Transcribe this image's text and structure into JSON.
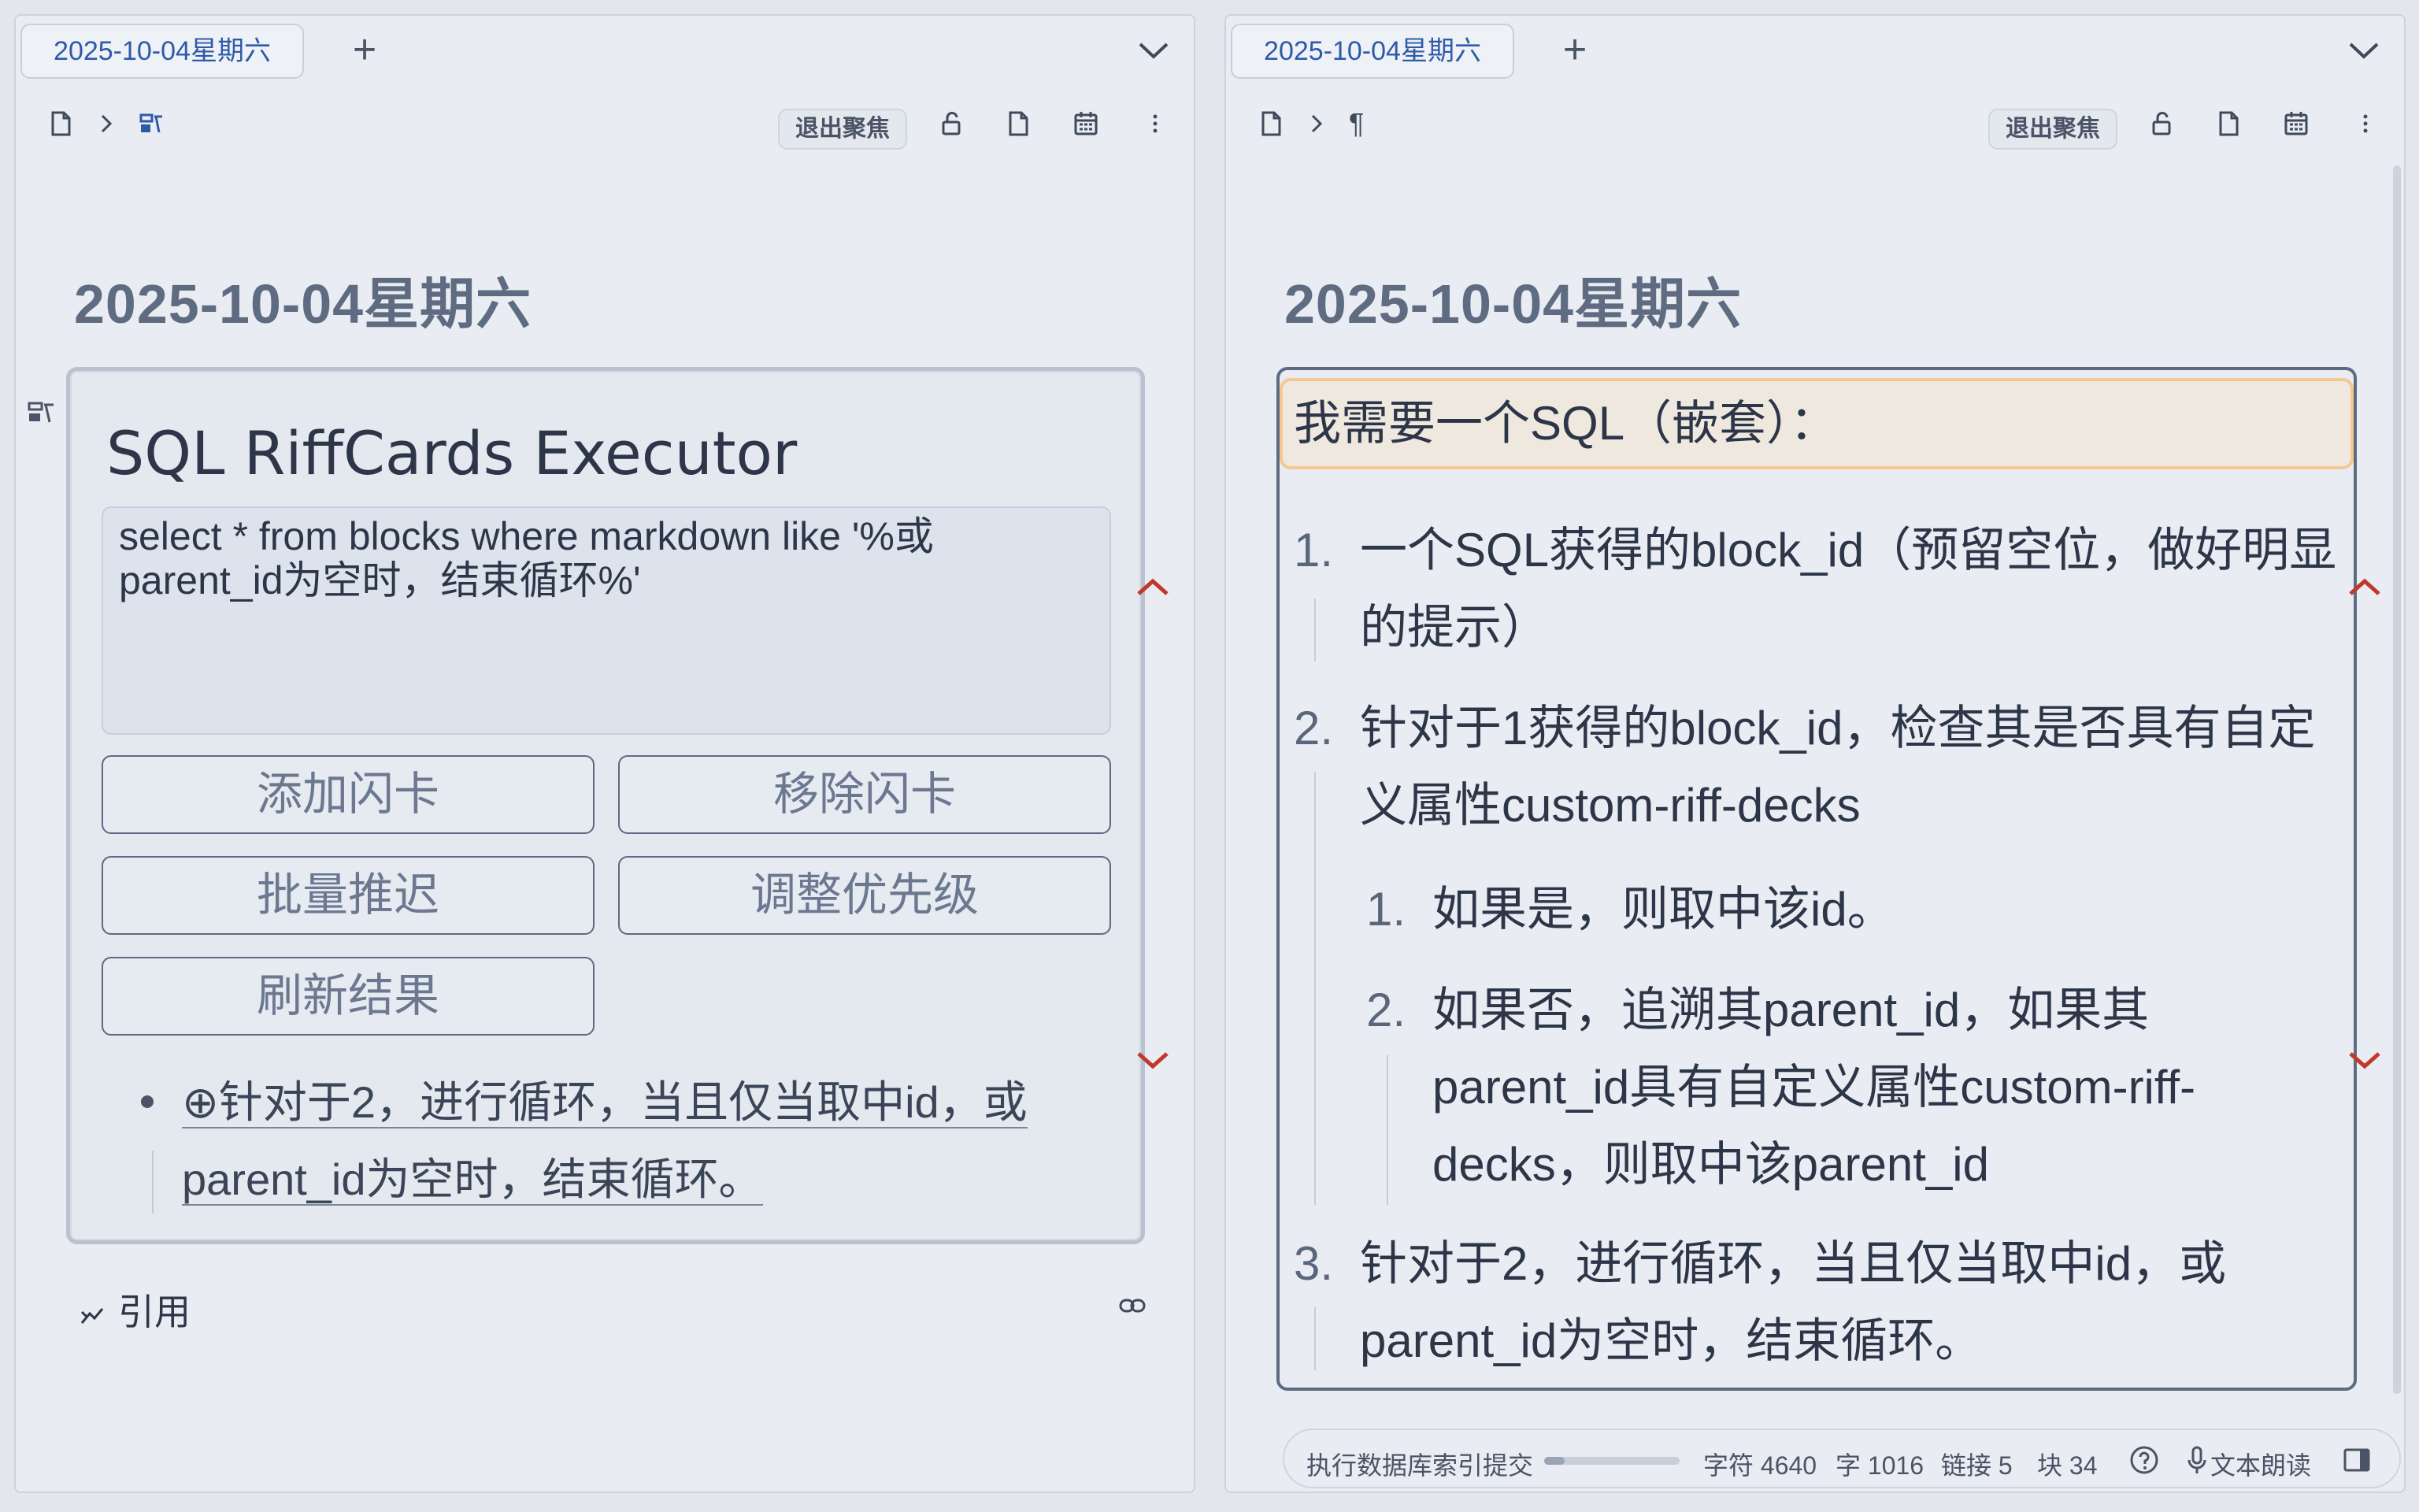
{
  "left": {
    "tab_label": "2025-10-04星期六",
    "exit_focus_label": "退出聚焦",
    "doc_title": "2025-10-04星期六",
    "widget": {
      "title": "SQL RiffCards Executor",
      "sql_query": "select * from blocks where markdown like '%或parent_id为空时，结束循环%'",
      "buttons": [
        "添加闪卡",
        "移除闪卡",
        "批量推迟",
        "调整优先级",
        "刷新结果"
      ],
      "result_line1": "⊕针对于2，进行循环，当且仅当取中id，或",
      "result_line2": "parent_id为空时，结束循环。"
    },
    "backlinks_label": "引用"
  },
  "right": {
    "tab_label": "2025-10-04星期六",
    "exit_focus_label": "退出聚焦",
    "doc_title": "2025-10-04星期六",
    "heading": "我需要一个SQL（嵌套）：",
    "items": [
      {
        "num": "1.",
        "line1": "一个SQL获得的block_id（预留空位，做好明显",
        "line2": "的提示）"
      },
      {
        "num": "2.",
        "line1": "针对于1获得的block_id，检查其是否具有自定",
        "line2": "义属性custom-riff-decks"
      },
      {
        "num": "1.",
        "line1": "如果是，则取中该id。"
      },
      {
        "num": "2.",
        "line1": "如果否，追溯其parent_id，如果其",
        "line2": "parent_id具有自定义属性custom-riff-",
        "line3": "decks，则取中该parent_id"
      },
      {
        "num": "3.",
        "line1": "针对于2，进行循环，当且仅当取中id，或",
        "line2": "parent_id为空时，结束循环。"
      }
    ],
    "status": {
      "task": "执行数据库索引提交",
      "progress": 0.15,
      "chars": "字符 4640",
      "words": "字 1016",
      "links": "链接 5",
      "blocks": "块 34",
      "read_aloud": "文本朗读"
    }
  },
  "colors": {
    "accent": "#2e5aa8",
    "chevron_red": "#c0392b",
    "focus_orange": "#f3c891"
  }
}
